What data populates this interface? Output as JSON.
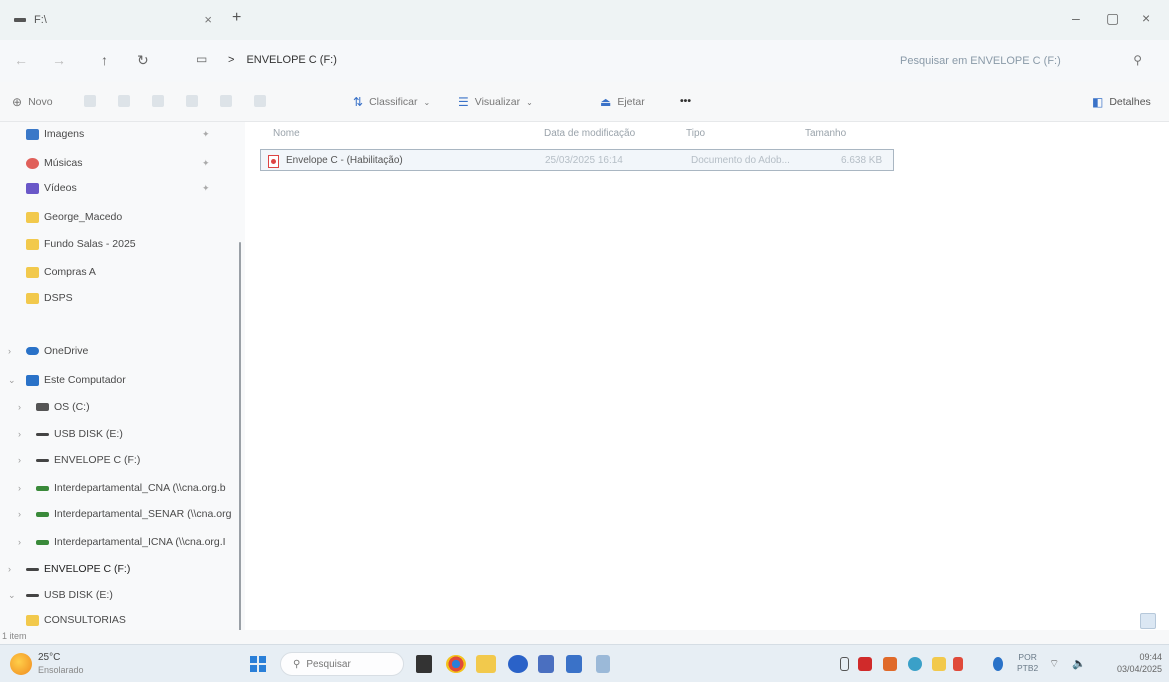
{
  "window": {
    "tab_title": "F:\\",
    "tab_close": "×",
    "new_tab": "+",
    "minimize": "–",
    "maximize": "▢",
    "close": "×"
  },
  "address": {
    "breadcrumb_sep": ">",
    "location": "ENVELOPE C (F:)",
    "search_placeholder": "Pesquisar em ENVELOPE C (F:)"
  },
  "toolbar": {
    "new_label": "Novo",
    "sort_label": "Classificar",
    "view_label": "Visualizar",
    "eject_label": "Ejetar",
    "more_label": "•••",
    "details_label": "Detalhes"
  },
  "sidebar": {
    "items": [
      {
        "label": "Imagens",
        "icon": "pictures-icon",
        "color": "#3a78c8"
      },
      {
        "label": "Músicas",
        "icon": "music-icon",
        "color": "#e0605a"
      },
      {
        "label": "Vídeos",
        "icon": "videos-icon",
        "color": "#6a58c8"
      },
      {
        "label": "George_Macedo",
        "icon": "folder-icon",
        "color": "#f2c94c"
      },
      {
        "label": "Fundo Salas - 2025",
        "icon": "folder-icon",
        "color": "#f2c94c"
      },
      {
        "label": "Compras A",
        "icon": "folder-icon",
        "color": "#f2c94c"
      },
      {
        "label": "DSPS",
        "icon": "folder-icon",
        "color": "#f2c94c"
      },
      {
        "label": "OneDrive",
        "icon": "onedrive-icon",
        "color": "#2a72c8"
      },
      {
        "label": "Este Computador",
        "icon": "computer-icon",
        "color": "#2a72c8"
      },
      {
        "label": "OS (C:)",
        "icon": "os-drive-icon",
        "color": "#555555"
      },
      {
        "label": "USB DISK (E:)",
        "icon": "usb-drive-icon",
        "color": "#444444"
      },
      {
        "label": "ENVELOPE C (F:)",
        "icon": "usb-drive-icon",
        "color": "#444444"
      },
      {
        "label": "Interdepartamental_CNA (\\\\cna.org.b",
        "icon": "network-drive-icon",
        "color": "#3a8a3a"
      },
      {
        "label": "Interdepartamental_SENAR (\\\\cna.org",
        "icon": "network-drive-icon",
        "color": "#3a8a3a"
      },
      {
        "label": "Interdepartamental_ICNA (\\\\cna.org.I",
        "icon": "network-drive-icon",
        "color": "#3a8a3a"
      },
      {
        "label": "ENVELOPE C (F:)",
        "icon": "usb-drive-icon",
        "color": "#444444"
      },
      {
        "label": "USB DISK (E:)",
        "icon": "usb-drive-icon",
        "color": "#444444"
      },
      {
        "label": "CONSULTORIAS",
        "icon": "folder-icon",
        "color": "#f2c94c"
      }
    ]
  },
  "table": {
    "headers": [
      "Nome",
      "Data de modificação",
      "Tipo",
      "Tamanho"
    ],
    "rows": [
      {
        "name": "Envelope C - (Habilitação)",
        "modified": "25/03/2025 16:14",
        "type": "Documento do Adob...",
        "size": "6.638 KB"
      }
    ]
  },
  "status": {
    "item_count": "1 item"
  },
  "taskbar": {
    "temp": "25°C",
    "weather": "Ensolarado",
    "search_placeholder": "Pesquisar",
    "lang_line1": "POR",
    "lang_line2": "PTB2",
    "time": "09:44",
    "date": "03/04/2025"
  }
}
